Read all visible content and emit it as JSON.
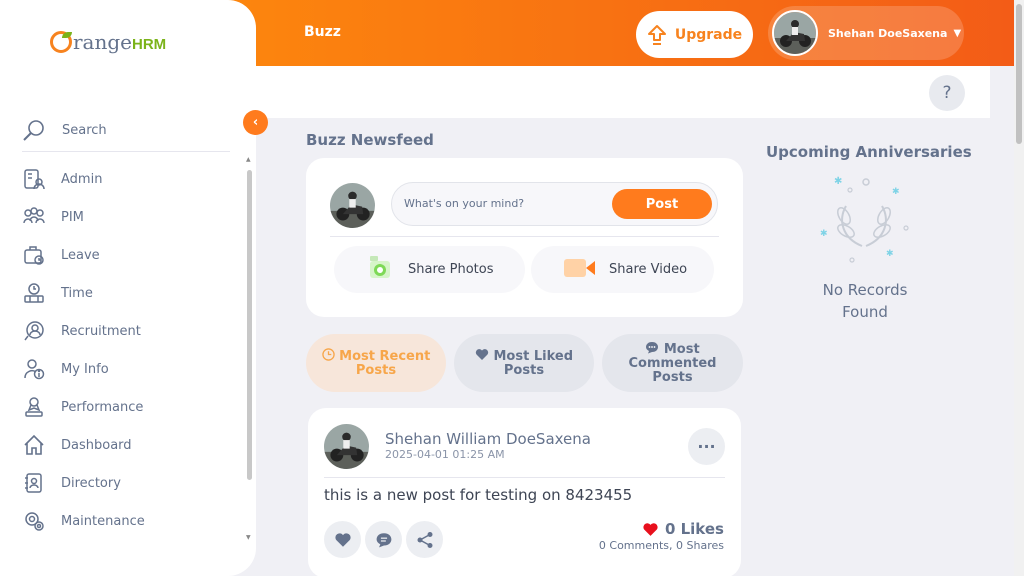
{
  "header": {
    "page_title": "Buzz",
    "upgrade_label": "Upgrade",
    "user_name": "Shehan DoeSaxena",
    "help_label": "?"
  },
  "sidebar": {
    "logo_text": "range",
    "logo_suffix": "HRM",
    "search_label": "Search",
    "items": [
      {
        "label": "Admin",
        "icon": "admin-icon"
      },
      {
        "label": "PIM",
        "icon": "pim-icon"
      },
      {
        "label": "Leave",
        "icon": "leave-icon"
      },
      {
        "label": "Time",
        "icon": "time-icon"
      },
      {
        "label": "Recruitment",
        "icon": "recruitment-icon"
      },
      {
        "label": "My Info",
        "icon": "my-info-icon"
      },
      {
        "label": "Performance",
        "icon": "performance-icon"
      },
      {
        "label": "Dashboard",
        "icon": "dashboard-icon"
      },
      {
        "label": "Directory",
        "icon": "directory-icon"
      },
      {
        "label": "Maintenance",
        "icon": "maintenance-icon"
      }
    ]
  },
  "feed": {
    "title": "Buzz Newsfeed",
    "compose": {
      "placeholder": "What's on your mind?",
      "post_label": "Post",
      "share_photos": "Share Photos",
      "share_video": "Share Video"
    },
    "tabs": [
      {
        "line1": "Most Recent",
        "line2": "Posts",
        "active": true
      },
      {
        "line1": "Most Liked",
        "line2": "Posts",
        "active": false
      },
      {
        "line1": "Most",
        "line2": "Commented",
        "line3": "Posts",
        "active": false
      }
    ],
    "post": {
      "author": "Shehan William DoeSaxena",
      "date": "2025-04-01 01:25 AM",
      "body": "this is a new post for testing on 8423455",
      "likes": "0 Likes",
      "stats": "0 Comments, 0 Shares"
    }
  },
  "anniversaries": {
    "title": "Upcoming Anniversaries",
    "empty_line1": "No Records",
    "empty_line2": "Found"
  },
  "colors": {
    "brand_orange": "#ff7b1d",
    "header_gradient_start": "#ff920b",
    "header_gradient_end": "#f35c17",
    "text": "#64728c",
    "logo_green": "#7bb31a"
  }
}
